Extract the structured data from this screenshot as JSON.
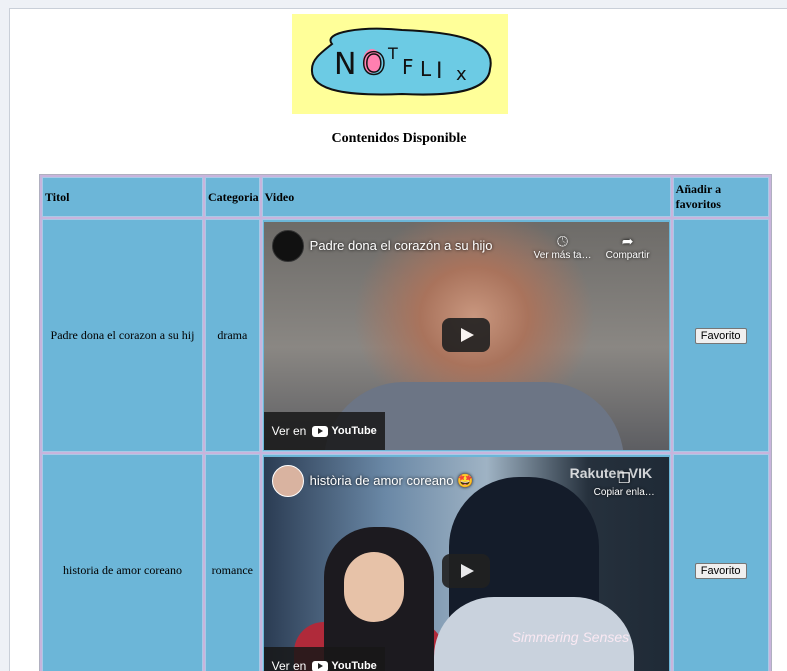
{
  "logo": {
    "text": "NOTFLIX",
    "bg": "#ffff99",
    "blob": "#6ccbe4"
  },
  "heading": "Contenidos Disponible",
  "table": {
    "headers": [
      "Titol",
      "Categoria",
      "Video",
      "Añadir a favoritos"
    ],
    "rows": [
      {
        "titol": "Padre dona el corazon a su hij",
        "categoria": "drama",
        "video": {
          "title": "Padre dona el corazón a su hijo",
          "watch_later": "Ver más ta…",
          "share": "Compartir",
          "watch_on": "Ver en",
          "youtube": "YouTube"
        },
        "favorito": "Favorito"
      },
      {
        "titol": "historia de amor coreano",
        "categoria": "romance",
        "video": {
          "title": "història de amor coreano 🤩",
          "copy": "Copiar enla…",
          "watch_on": "Ver en",
          "youtube": "YouTube",
          "watermark_top": "Rakuten VIK",
          "watermark_bottom": "Simmering Senses"
        },
        "favorito": "Favorito"
      }
    ]
  },
  "colors": {
    "cell": "#6cb6d8",
    "grid": "#c8b4dc"
  }
}
